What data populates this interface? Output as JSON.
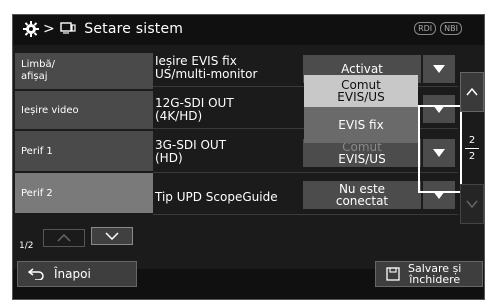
{
  "window": {
    "title_prefix": "> ",
    "title": "Setare sistem",
    "badges": [
      "RDI",
      "NBI"
    ]
  },
  "sidebar": {
    "items": [
      {
        "label": "Limbă/\nafișaj",
        "active": false
      },
      {
        "label": "Ieșire video",
        "active": false
      },
      {
        "label": "Perif 1",
        "active": false
      },
      {
        "label": "Perif 2",
        "active": true
      }
    ],
    "page_indicator": "1/2"
  },
  "settings": [
    {
      "label_line1": "Ieșire EVIS fix",
      "label_line2": "US/multi-monitor",
      "value": "Activat"
    },
    {
      "label_line1": "12G-SDI OUT",
      "label_line2": "(4K/HD)",
      "value": "Comut EVIS/US"
    },
    {
      "label_line1": "3G-SDI OUT",
      "label_line2": "(HD)",
      "value_line1": "Comut",
      "value_line2": "EVIS/US"
    },
    {
      "label_line1": "Tip UPD ScopeGuide",
      "label_line2": "",
      "value_line1": "Nu este",
      "value_line2": "conectat"
    }
  ],
  "dropdown": {
    "options": [
      {
        "line1": "Comut",
        "line2": "EVIS/US",
        "selected": false
      },
      {
        "line1": "EVIS fix",
        "line2": "",
        "selected": true
      }
    ]
  },
  "scroll": {
    "current_page": "2",
    "total_pages": "2"
  },
  "footer": {
    "back_label": "Înapoi",
    "save_line1": "Salvare și",
    "save_line2": "închidere"
  },
  "colors": {
    "panel": "#1b1b1b",
    "button": "#4c4c4c",
    "active_tab": "#7a7a7a",
    "dropdown_option": "#c8c8c8",
    "dropdown_selected": "#6a6a6a"
  }
}
